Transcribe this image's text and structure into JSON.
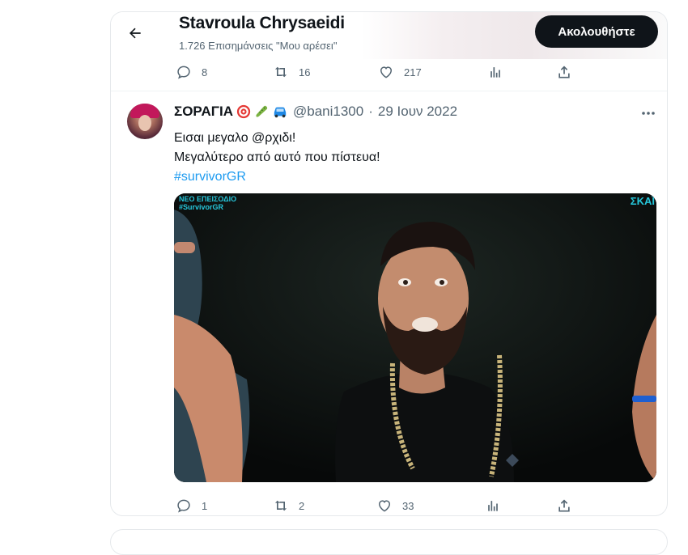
{
  "header": {
    "profile_name": "Stavroula Chrysaeidi",
    "likes_label": "1.726 Επισημάνσεις \"Μου αρέσει\"",
    "follow_label": "Ακολουθήστε"
  },
  "prev_tweet": {
    "replies": "8",
    "retweets": "16",
    "likes": "217"
  },
  "tweet": {
    "author_name": "ΣΟΡΑΓΙΑ",
    "emojis": [
      "target-emoji",
      "cucumber-emoji",
      "car-emoji"
    ],
    "handle": "@bani1300",
    "separator": "·",
    "date": "29 Ιουν 2022",
    "text_line1": "Εισαι μεγαλο @ρχιδι!",
    "text_line2": "Μεγαλύτερο από αυτό που πίστευα!",
    "hashtag": "#survivorGR",
    "media": {
      "overlay_line1": "ΝΕΟ ΕΠΕΙΣΟΔΙΟ",
      "overlay_line2": "#SurvivorGR",
      "channel": "ΣΚΑΪ"
    },
    "replies": "1",
    "retweets": "2",
    "likes": "33"
  },
  "colors": {
    "text": "#0f1419",
    "secondary": "#536471",
    "link": "#1d9bf0",
    "follow_bg": "#0f1419"
  }
}
